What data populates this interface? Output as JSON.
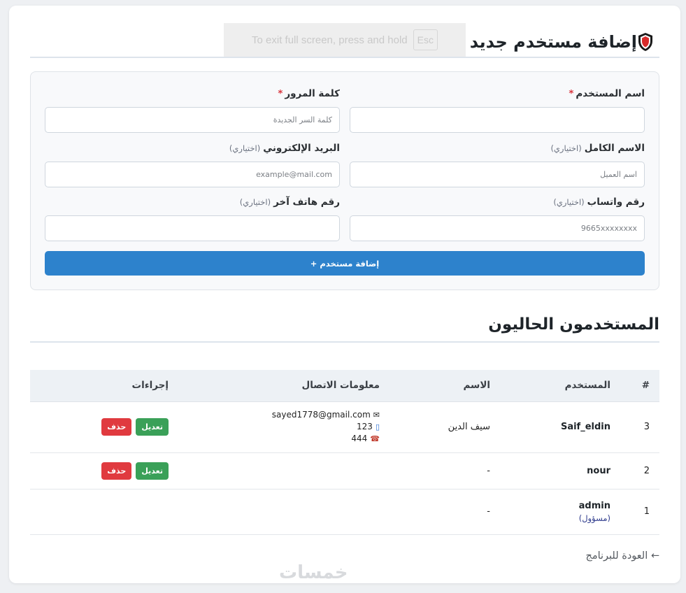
{
  "header": {
    "title": "إضافة مستخدم جديد",
    "fullscreen_notice": "To exit full screen, press and hold",
    "fullscreen_key": "Esc"
  },
  "form": {
    "username": {
      "label": "اسم المستخدم",
      "required_mark": "*",
      "value": "",
      "placeholder": ""
    },
    "password": {
      "label": "كلمة المرور",
      "required_mark": "*",
      "value": "",
      "placeholder": "كلمة السر الجديدة"
    },
    "fullname": {
      "label": "الاسم الكامل",
      "optional": "(اختياري)",
      "value": "",
      "placeholder": "اسم العميل"
    },
    "email": {
      "label": "البريد الإلكتروني",
      "optional": "(اختياري)",
      "value": "",
      "placeholder": "example@mail.com"
    },
    "whatsapp": {
      "label": "رقم واتساب",
      "optional": "(اختياري)",
      "value": "",
      "placeholder": "9665xxxxxxxx"
    },
    "other_phone": {
      "label": "رقم هاتف آخر",
      "optional": "(اختياري)",
      "value": "",
      "placeholder": ""
    },
    "submit_label": "إضافة مستخدم +"
  },
  "users_section": {
    "title": "المستخدمون الحاليون",
    "columns": [
      "#",
      "المستخدم",
      "الاسم",
      "معلومات الاتصال",
      "إجراءات"
    ],
    "rows": [
      {
        "num": "3",
        "username": "Saif_eldin",
        "role": "",
        "name": "سيف الدين",
        "email": "sayed1778@gmail.com",
        "whatsapp": "123",
        "phone": "444",
        "edit": "تعديل",
        "delete": "حذف"
      },
      {
        "num": "2",
        "username": "nour",
        "role": "",
        "name": "-",
        "email": "",
        "whatsapp": "",
        "phone": "",
        "edit": "تعديل",
        "delete": "حذف"
      },
      {
        "num": "1",
        "username": "admin",
        "role": "(مسؤول)",
        "name": "-",
        "email": "",
        "whatsapp": "",
        "phone": "",
        "edit": "",
        "delete": ""
      }
    ]
  },
  "footer": {
    "back_label": "← العودة للبرنامج",
    "watermark": "خمسات"
  },
  "icons": {
    "email": "envelope-icon",
    "mobile": "mobile-phone-icon",
    "phone": "telephone-icon",
    "title": "shield-icon"
  },
  "colors": {
    "primary": "#2d82cc",
    "edit": "#3aa058",
    "delete": "#e03a3f",
    "required": "#d9363e"
  }
}
